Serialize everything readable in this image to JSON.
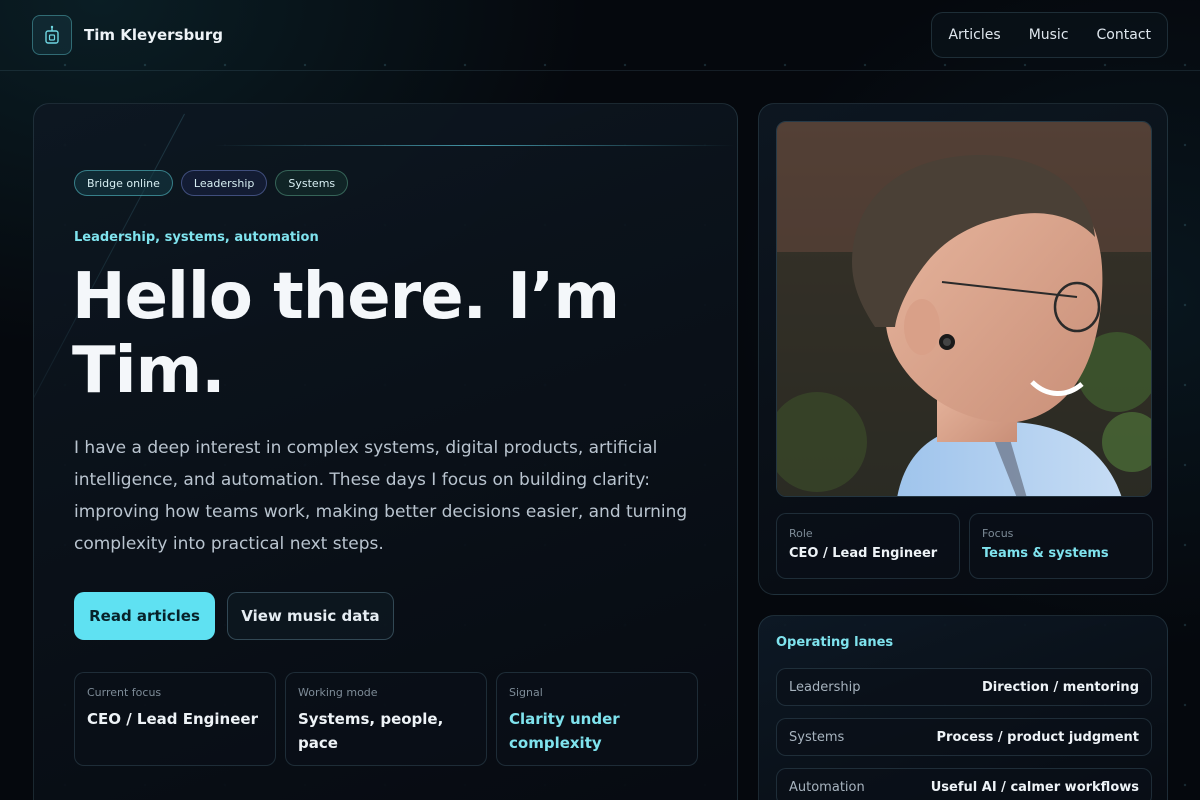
{
  "header": {
    "brand_name": "Tim Kleyersburg",
    "logo_icon": "robot-icon",
    "nav": [
      {
        "label": "Articles"
      },
      {
        "label": "Music"
      },
      {
        "label": "Contact"
      }
    ]
  },
  "hero": {
    "chips": [
      {
        "label": "Bridge online"
      },
      {
        "label": "Leadership"
      },
      {
        "label": "Systems"
      }
    ],
    "eyebrow": "Leadership, systems, automation",
    "headline": "Hello there. I’m Tim.",
    "lead": "I have a deep interest in complex systems, digital products, artificial intelligence, and automation. These days I focus on building clarity: improving how teams work, making better decisions easier, and turning complexity into practical next steps.",
    "primary_button": "Read articles",
    "secondary_button": "View music data",
    "stats": [
      {
        "label": "Current focus",
        "value": "CEO / Lead Engineer"
      },
      {
        "label": "Working mode",
        "value": "Systems, people, pace"
      },
      {
        "label": "Signal",
        "value": "Clarity under complexity"
      }
    ]
  },
  "profile": {
    "meta": [
      {
        "label": "Role",
        "value": "CEO / Lead Engineer"
      },
      {
        "label": "Focus",
        "value": "Teams & systems"
      }
    ]
  },
  "lanes": {
    "title": "Operating lanes",
    "items": [
      {
        "label": "Leadership",
        "value": "Direction / mentoring"
      },
      {
        "label": "Systems",
        "value": "Process / product judgment"
      },
      {
        "label": "Automation",
        "value": "Useful AI / calmer workflows"
      }
    ]
  },
  "colors": {
    "accent": "#5fe1f2",
    "background": "#05080d"
  }
}
